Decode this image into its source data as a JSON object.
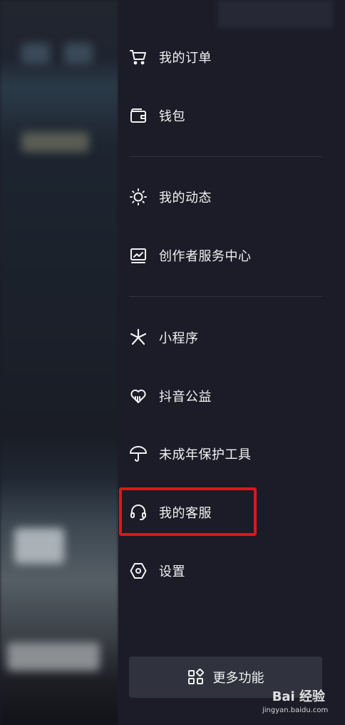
{
  "drawer": {
    "groups": [
      {
        "items": [
          {
            "label": "我的订单",
            "icon": "cart-icon"
          },
          {
            "label": "钱包",
            "icon": "wallet-icon"
          }
        ]
      },
      {
        "items": [
          {
            "label": "我的动态",
            "icon": "sun-icon"
          },
          {
            "label": "创作者服务中心",
            "icon": "monitor-chart-icon"
          }
        ]
      },
      {
        "items": [
          {
            "label": "小程序",
            "icon": "asterisk-icon"
          },
          {
            "label": "抖音公益",
            "icon": "heart-icon"
          },
          {
            "label": "未成年保护工具",
            "icon": "umbrella-icon"
          },
          {
            "label": "我的客服",
            "icon": "headset-icon"
          },
          {
            "label": "设置",
            "icon": "hexagon-settings-icon"
          }
        ]
      }
    ],
    "highlighted_item": "我的客服",
    "more_button": {
      "label": "更多功能",
      "icon": "grid-icon"
    }
  },
  "watermark": {
    "text": "Bai 经验",
    "url": "jingyan.baidu.com"
  },
  "colors": {
    "drawer_bg": "#1b1c27",
    "text": "#f2f2f4",
    "highlight_border": "#e0141e",
    "button_bg": "#30323d"
  }
}
